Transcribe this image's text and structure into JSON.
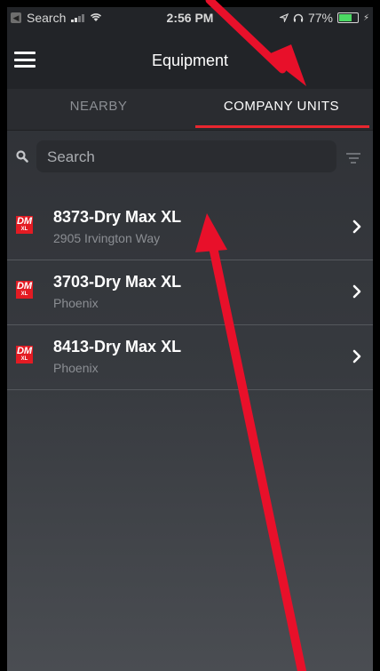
{
  "status_bar": {
    "back_app": "Search",
    "time": "2:56 PM",
    "battery": "77%",
    "battery_level": 0.77
  },
  "nav": {
    "title": "Equipment"
  },
  "tabs": [
    {
      "label": "NEARBY",
      "active": false
    },
    {
      "label": "COMPANY UNITS",
      "active": true
    }
  ],
  "search": {
    "placeholder": "Search",
    "value": ""
  },
  "logo": {
    "top": "DM",
    "bottom": "XL"
  },
  "units": [
    {
      "title": "8373-Dry Max XL",
      "subtitle": "2905 Irvington Way"
    },
    {
      "title": "3703-Dry Max XL",
      "subtitle": "Phoenix"
    },
    {
      "title": "8413-Dry Max XL",
      "subtitle": "Phoenix"
    }
  ],
  "colors": {
    "accent": "#e8262f",
    "annotation_arrow": "#e8102a",
    "background": "#33363b",
    "logo_red": "#e31b23"
  }
}
